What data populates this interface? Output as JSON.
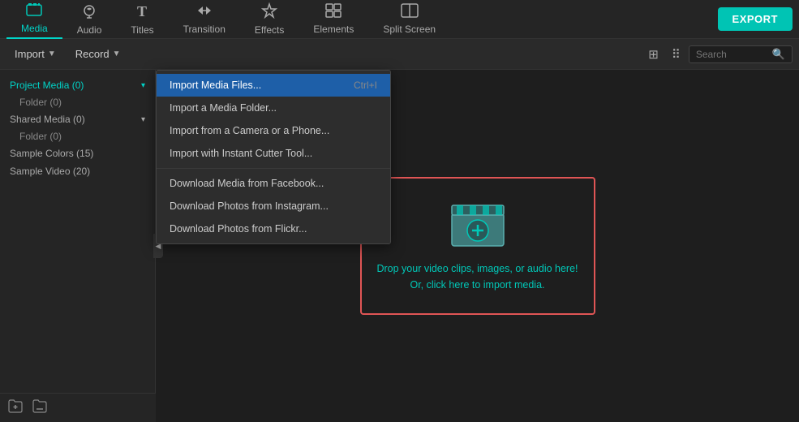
{
  "topNav": {
    "items": [
      {
        "id": "media",
        "label": "Media",
        "icon": "🖼",
        "active": true
      },
      {
        "id": "audio",
        "label": "Audio",
        "icon": "♪"
      },
      {
        "id": "titles",
        "label": "Titles",
        "icon": "T"
      },
      {
        "id": "transition",
        "label": "Transition",
        "icon": "⇄"
      },
      {
        "id": "effects",
        "label": "Effects",
        "icon": "✨"
      },
      {
        "id": "elements",
        "label": "Elements",
        "icon": "⊞"
      },
      {
        "id": "splitscreen",
        "label": "Split Screen",
        "icon": "⊟"
      }
    ],
    "exportLabel": "EXPORT"
  },
  "secondBar": {
    "importLabel": "Import",
    "recordLabel": "Record",
    "searchPlaceholder": "Search"
  },
  "sidebar": {
    "items": [
      {
        "label": "Project Media (0)",
        "active": true,
        "expandable": true
      },
      {
        "label": "Folder (0)",
        "sub": true
      },
      {
        "label": "Shared Media (0)",
        "expandable": true
      },
      {
        "label": "Folder (0)",
        "sub": true
      },
      {
        "label": "Sample Colors (15)"
      },
      {
        "label": "Sample Video (20)"
      }
    ],
    "bottomIcons": [
      "⊕",
      "⊞"
    ]
  },
  "dropdown": {
    "items": [
      {
        "label": "Import Media Files...",
        "shortcut": "Ctrl+I",
        "highlighted": true
      },
      {
        "label": "Import a Media Folder..."
      },
      {
        "label": "Import from a Camera or a Phone..."
      },
      {
        "label": "Import with Instant Cutter Tool..."
      },
      {
        "divider": true
      },
      {
        "label": "Download Media from Facebook..."
      },
      {
        "label": "Download Photos from Instagram..."
      },
      {
        "label": "Download Photos from Flickr..."
      }
    ]
  },
  "dropZone": {
    "line1": "Drop your video clips, images, or audio here!",
    "line2": "Or, click here to import media."
  },
  "colors": {
    "accent": "#00c8b8",
    "highlight": "#1e5fa8",
    "dropBorder": "#e05555"
  }
}
